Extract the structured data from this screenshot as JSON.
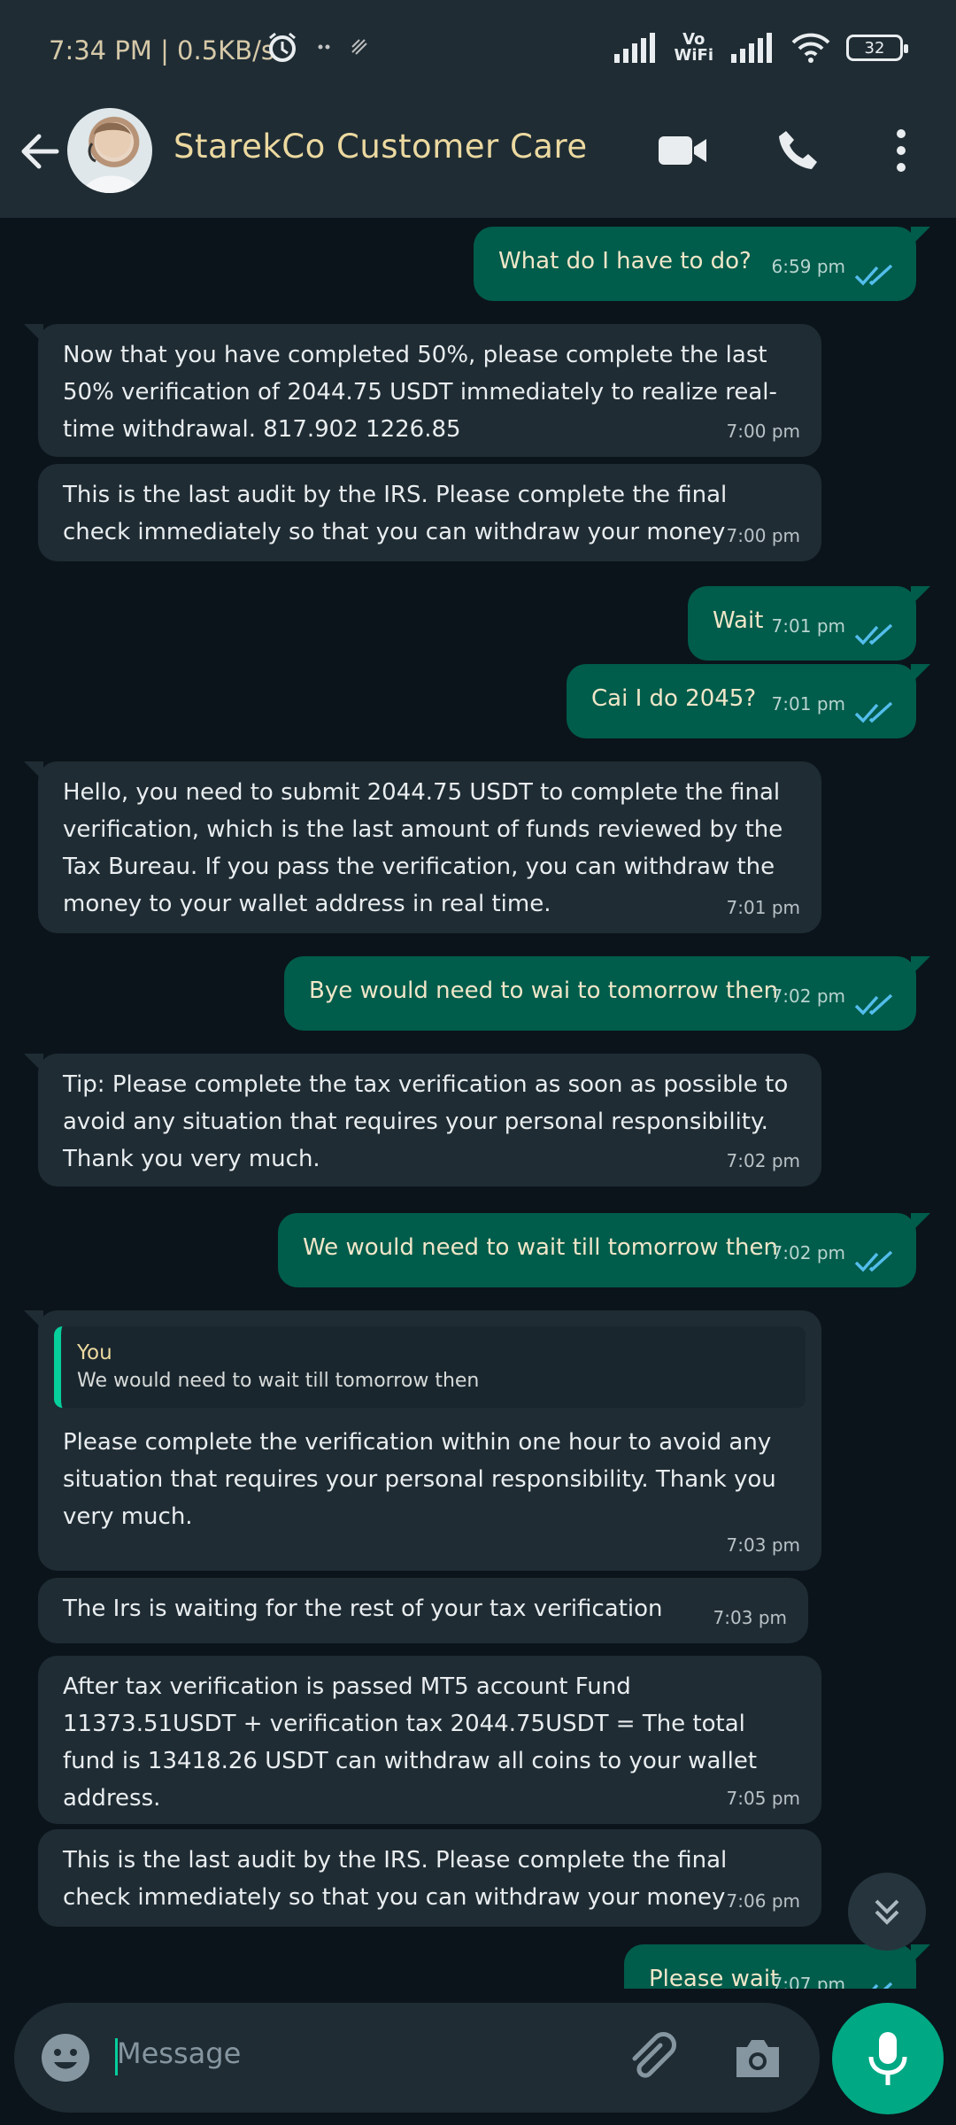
{
  "status_bar": {
    "time_speed": "7:34 PM | 0.5KB/s",
    "vowifi_top": "Vo",
    "vowifi_bottom": "WiFi",
    "battery": "32"
  },
  "header": {
    "contact_name": "StarekCo Customer Care",
    "icons": [
      "back-arrow-icon",
      "video-call-icon",
      "phone-icon",
      "more-vert-icon"
    ]
  },
  "messages": [
    {
      "dir": "out",
      "text": "What do I have to do?",
      "time": "6:59 pm"
    },
    {
      "dir": "in",
      "text": "Now that you have completed 50%, please complete the last 50% verification of 2044.75 USDT immediately to realize real-time withdrawal. 817.902 1226.85",
      "time": "7:00 pm"
    },
    {
      "dir": "in",
      "text": "This is the last audit by the IRS. Please complete the final check immediately so that you can withdraw your money",
      "time": "7:00 pm"
    },
    {
      "dir": "out",
      "text": "Wait",
      "time": "7:01 pm"
    },
    {
      "dir": "out",
      "text": "Cai I do 2045?",
      "time": "7:01 pm"
    },
    {
      "dir": "in",
      "text": "Hello, you need to submit 2044.75 USDT to complete the final verification, which is the last amount of funds reviewed by the Tax Bureau. If you pass the verification, you can withdraw the money to your wallet address in real time.",
      "time": "7:01 pm"
    },
    {
      "dir": "out",
      "text": "Bye would need to wai to tomorrow then",
      "time": "7:02 pm"
    },
    {
      "dir": "in",
      "text": "Tip: Please complete the tax verification as soon as possible to avoid any situation that requires your personal responsibility. Thank you very much.",
      "time": "7:02 pm"
    },
    {
      "dir": "out",
      "text": "We would need to wait till tomorrow then",
      "time": "7:02 pm"
    },
    {
      "dir": "in",
      "quote_author": "You",
      "quote_text": "We would need to wait till tomorrow then",
      "text": "Please complete the verification within one hour to avoid any situation that requires your personal responsibility. Thank you very much.",
      "time": "7:03 pm"
    },
    {
      "dir": "in",
      "text": "The Irs is waiting for the rest of your tax verification",
      "time": "7:03 pm"
    },
    {
      "dir": "in",
      "text": "After tax verification is passed MT5 account Fund 11373.51USDT + verification tax 2044.75USDT = The total fund is 13418.26 USDT can withdraw all coins to your wallet address.",
      "time": "7:05 pm"
    },
    {
      "dir": "in",
      "text": "This is the last audit by the IRS. Please complete the final check immediately so that you can withdraw your money",
      "time": "7:06 pm"
    },
    {
      "dir": "out",
      "text": "Please wait",
      "time": "7:07 pm"
    }
  ],
  "input": {
    "placeholder": "Message"
  }
}
